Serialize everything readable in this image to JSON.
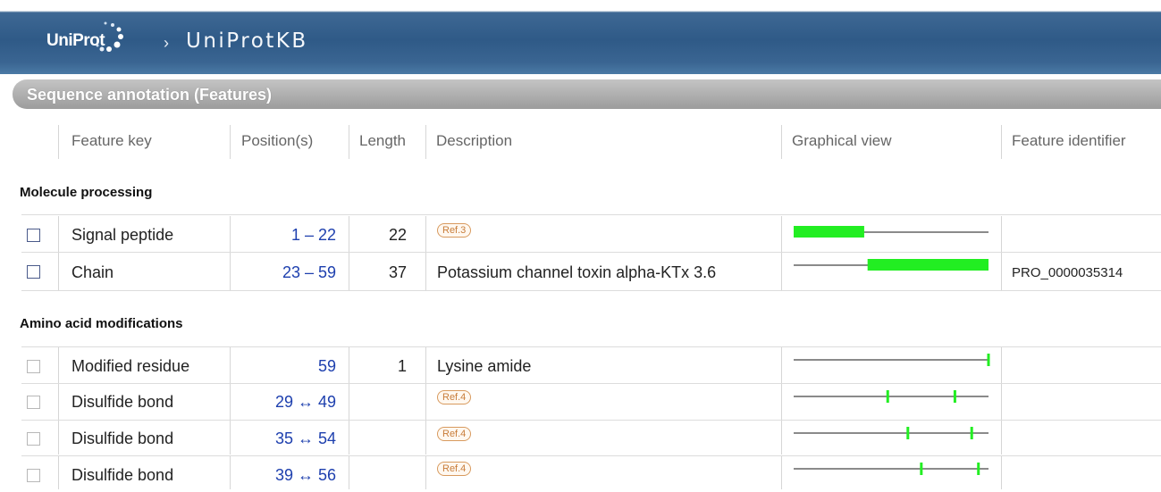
{
  "header": {
    "logo_text": "UniProt",
    "separator": "›",
    "breadcrumb": "UniProtKB"
  },
  "section": {
    "title": "Sequence annotation (Features)"
  },
  "columns": [
    "Feature key",
    "Position(s)",
    "Length",
    "Description",
    "Graphical view",
    "Feature identifier"
  ],
  "groups": [
    {
      "title": "Molecule processing"
    },
    {
      "title": "Amino acid modifications"
    }
  ],
  "rows": [
    {
      "key": "Signal peptide",
      "position": "1 – 22",
      "length": "22",
      "description": "",
      "ref": "Ref.3",
      "identifier": "",
      "checkbox": "dark"
    },
    {
      "key": "Chain",
      "position": "23 – 59",
      "length": "37",
      "description": "Potassium channel toxin alpha-KTx 3.6",
      "ref": "",
      "identifier": "PRO_0000035314",
      "checkbox": "dark"
    },
    {
      "key": "Modified residue",
      "position": "59",
      "length": "1",
      "description": "Lysine amide",
      "ref": "",
      "identifier": "",
      "checkbox": "light"
    },
    {
      "key": "Disulfide bond",
      "position": "29 ↔ 49",
      "length": "",
      "description": "",
      "ref": "Ref.4",
      "identifier": "",
      "checkbox": "light"
    },
    {
      "key": "Disulfide bond",
      "position": "35 ↔ 54",
      "length": "",
      "description": "",
      "ref": "Ref.4",
      "identifier": "",
      "checkbox": "light"
    },
    {
      "key": "Disulfide bond",
      "position": "39 ↔ 56",
      "length": "",
      "description": "",
      "ref": "Ref.4",
      "identifier": "",
      "checkbox": "light"
    }
  ],
  "graphics": {
    "sequence_length": 59,
    "feature_color": "#22ee22",
    "line_color": "#444444",
    "features": [
      {
        "type": "range",
        "start": 1,
        "end": 22
      },
      {
        "type": "range",
        "start": 23,
        "end": 59
      },
      {
        "type": "marks",
        "positions": [
          59
        ]
      },
      {
        "type": "marks",
        "positions": [
          29,
          49
        ]
      },
      {
        "type": "marks",
        "positions": [
          35,
          54
        ]
      },
      {
        "type": "marks",
        "positions": [
          39,
          56
        ]
      }
    ]
  },
  "colors": {
    "link_blue": "#1d3fae",
    "header_blue": "#2f5a87",
    "section_gray": "#a8a8a8",
    "ref_orange": "#c87d3a"
  }
}
